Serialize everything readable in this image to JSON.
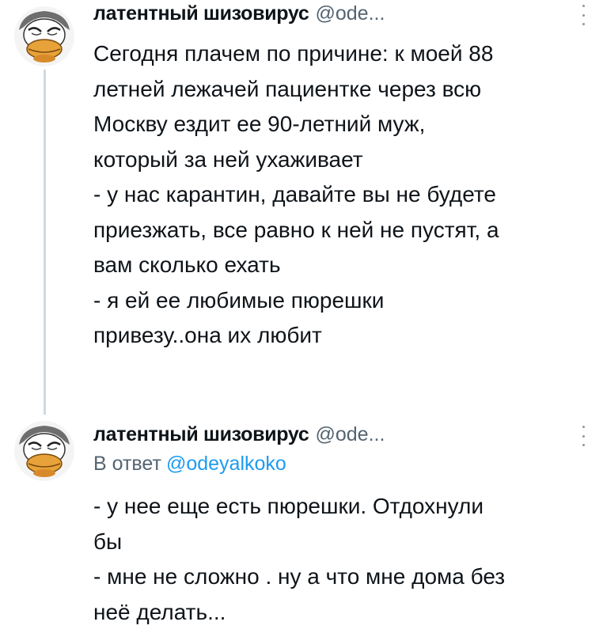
{
  "tweets": [
    {
      "display_name": "латентный шизовирус",
      "handle": "@ode...",
      "more_icon": "more-vertical-icon",
      "lines": [
        "Сегодня плачем по причине: к моей 88",
        "летней лежачей пациентке через всю",
        "Москву ездит ее 90-летний муж,",
        "который за ней ухаживает",
        "- у нас карантин, давайте вы не будете",
        "приезжать, все равно к ней не пустят, а",
        "вам сколько ехать",
        "- я ей ее любимые пюрешки",
        "привезу..она их любит"
      ]
    },
    {
      "display_name": "латентный шизовирус",
      "handle": "@ode...",
      "more_icon": "more-vertical-icon",
      "reply_prefix": "В ответ",
      "reply_mention": "@odeyalkoko",
      "lines": [
        "- у нее еще есть пюрешки. Отдохнули",
        "бы",
        "- мне не сложно . ну а что мне дома без",
        "неё делать..."
      ]
    }
  ],
  "colors": {
    "text": "#0f1419",
    "secondary": "#536471",
    "link": "#1d9bf0",
    "thread_line": "#cfd9de"
  }
}
